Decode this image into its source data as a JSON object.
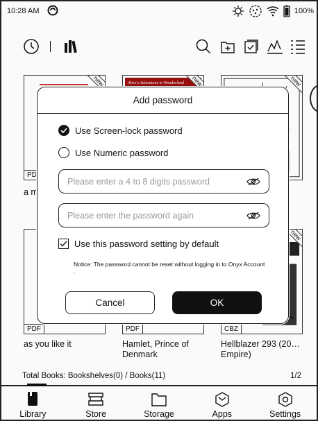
{
  "status_bar": {
    "time": "10:28 AM",
    "battery_percent": "100%",
    "icons": [
      "dnd-icon",
      "brightness-icon",
      "refresh-icon",
      "wifi-icon",
      "battery-icon"
    ]
  },
  "toolbar": {
    "left_icons": [
      "history-icon",
      "bookshelf-icon"
    ],
    "right_icons": [
      "search-icon",
      "import-icon",
      "select-icon",
      "stats-icon",
      "list-view-icon"
    ]
  },
  "books": [
    {
      "format": "PDF",
      "title": "a m… nigh…",
      "badge": "new"
    },
    {
      "format": "",
      "title": "",
      "badge": "new",
      "cover_text": "Alice's Adventures in Wonderland"
    },
    {
      "format": "",
      "title": "",
      "badge": "new"
    },
    {
      "format": "PDF",
      "title": "as you like it",
      "badge": ""
    },
    {
      "format": "PDF",
      "title": "Hamlet, Prince of Denmark",
      "badge": ""
    },
    {
      "format": "CBZ",
      "title": "Hellblazer 293 (20… Empire)",
      "badge": "new"
    }
  ],
  "footer": {
    "total_books": "Total Books: Bookshelves(0) / Books(11)",
    "page": "1/2"
  },
  "nav": [
    {
      "label": "Library",
      "icon": "library-icon"
    },
    {
      "label": "Store",
      "icon": "store-icon"
    },
    {
      "label": "Storage",
      "icon": "storage-icon"
    },
    {
      "label": "Apps",
      "icon": "apps-icon"
    },
    {
      "label": "Settings",
      "icon": "settings-icon"
    }
  ],
  "dialog": {
    "title": "Add password",
    "option_screen_lock": "Use Screen-lock password",
    "option_numeric": "Use Numeric password",
    "selected_option": "screen_lock",
    "password_placeholder": "Please enter a 4 to 8 digits password",
    "confirm_placeholder": "Please enter the password again",
    "default_checkbox_label": "Use this password setting by default",
    "default_checked": true,
    "notice": "Notice: The password cannot be reset without logging in to Onyx Account .",
    "cancel_label": "Cancel",
    "ok_label": "OK"
  }
}
